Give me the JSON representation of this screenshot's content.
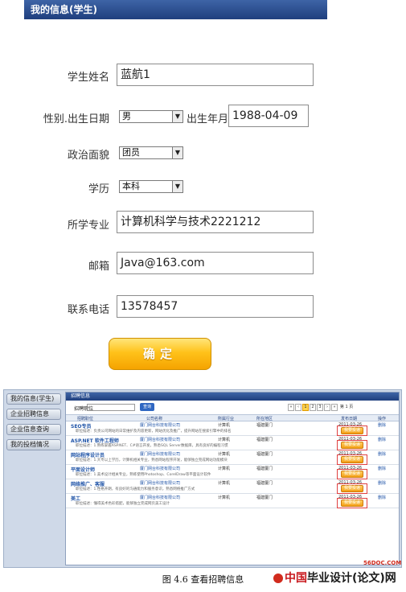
{
  "form": {
    "header": "我的信息(学生)",
    "name_label": "学生姓名",
    "name_value": "蓝航1",
    "gender_birth_label": "性别.出生日期",
    "gender_value": "男",
    "birth_label": "出生年月",
    "birth_value": "1988-04-09",
    "political_label": "政治面貌",
    "political_value": "团员",
    "education_label": "学历",
    "education_value": "本科",
    "major_label": "所学专业",
    "major_value": "计算机科学与技术2221212",
    "email_label": "邮箱",
    "email_value": "Java@163.com",
    "phone_label": "联系电话",
    "phone_value": "13578457",
    "confirm_button": "确定"
  },
  "lower": {
    "nav": [
      "我的信息(学生)",
      "企业招聘信息",
      "企业信息查询",
      "我的投档情况"
    ],
    "tab": "招聘信息",
    "filter_label": "招聘职位",
    "search_button": "查询",
    "pager": [
      "1",
      "2",
      "3"
    ],
    "pager_suffix": "第 1 页",
    "columns": [
      "招聘职位",
      "公司名称",
      "所属行业",
      "所在地区",
      "发布日期",
      "操作"
    ],
    "jobs": [
      {
        "title": "SEO专员",
        "company": "厦门网台科技有限公司",
        "industry": "计算机",
        "location": "福建厦门",
        "date": "2011-03-26",
        "desc": "职位描述：负责公司网站的日常维护及内容更新，网站优化及推广，提升网站在搜索引擎中的排名",
        "apply": "我要投递",
        "del": "删除"
      },
      {
        "title": "ASP.NET 软件工程师",
        "company": "厦门网台科技有限公司",
        "industry": "计算机",
        "location": "福建厦门",
        "date": "2011-03-26",
        "desc": "职位描述：1.熟练掌握ASP.NET、C#语言开发，熟悉SQL Server数据库，具有良好的编程习惯",
        "apply": "我要投递",
        "del": "删除"
      },
      {
        "title": "网站程序设计员",
        "company": "厦门网台科技有限公司",
        "industry": "计算机",
        "location": "福建厦门",
        "date": "2011-03-26",
        "desc": "职位描述：1.大专以上学历，计算机相关专业，熟悉网站程序开发，能够独立完成网站功能模块",
        "apply": "我要投递",
        "del": "删除"
      },
      {
        "title": "平面设计师",
        "company": "厦门网台科技有限公司",
        "industry": "计算机",
        "location": "福建厦门",
        "date": "2011-03-26",
        "desc": "职位描述：1.美术设计相关专业，熟练使用Photoshop、CorelDraw等平面设计软件",
        "apply": "我要投递",
        "del": "删除"
      },
      {
        "title": "网络推广、客服",
        "company": "厦门网台科技有限公司",
        "industry": "计算机",
        "location": "福建厦门",
        "date": "2011-03-26",
        "desc": "职位描述：1.性格开朗，有良好的沟通能力和服务意识，熟悉网络推广方式",
        "apply": "我要投递",
        "del": "删除"
      },
      {
        "title": "美工",
        "company": "厦门网台科技有限公司",
        "industry": "计算机",
        "location": "福建厦门",
        "date": "2011-03-26",
        "desc": "职位描述：懂得美术色彩搭配，能够独立完成网页美工设计",
        "apply": "我要投递",
        "del": "删除"
      }
    ]
  },
  "caption": "图 4.6 查看招聘信息",
  "footer": {
    "site": "56DOC.COM",
    "logo_red": "中国",
    "logo_black": "毕业设计(论文)网"
  }
}
